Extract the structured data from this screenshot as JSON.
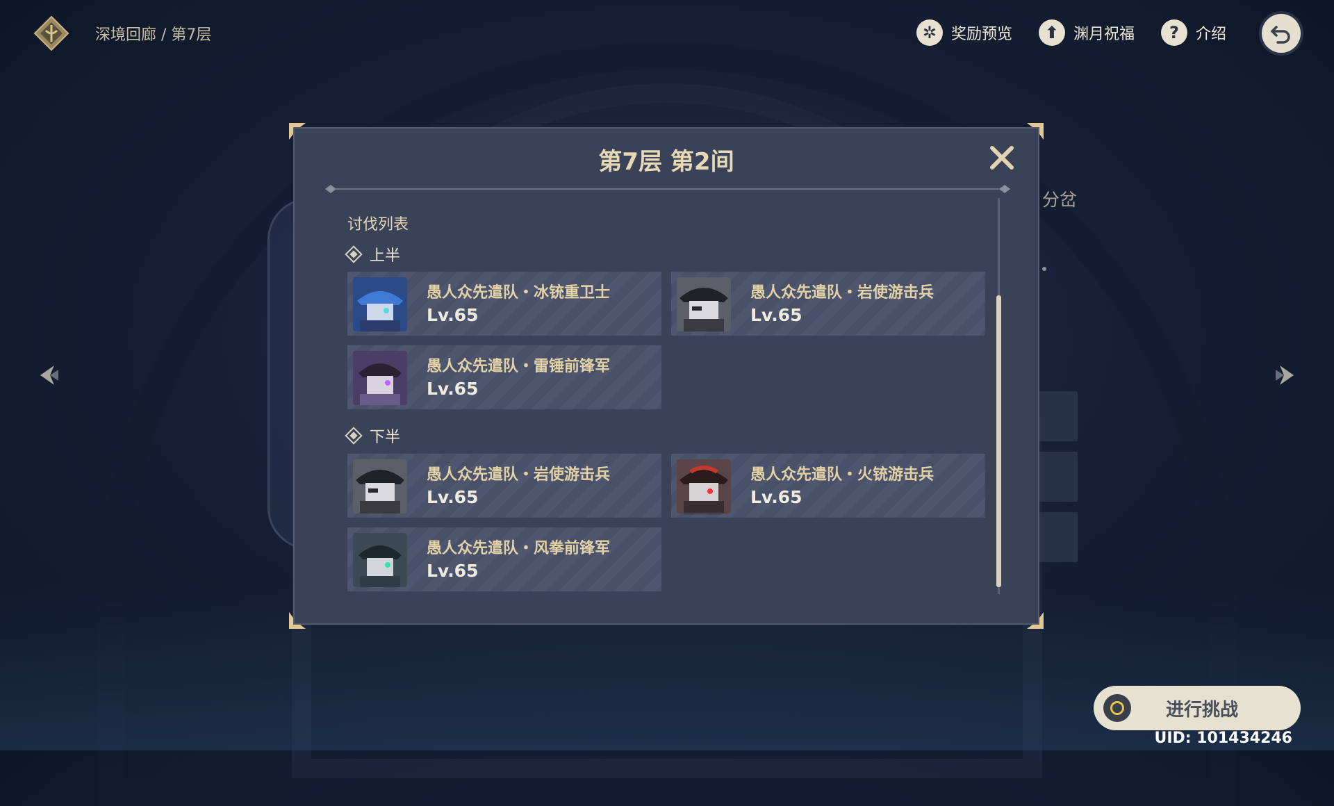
{
  "breadcrumb": "深境回廊 / 第7层",
  "top_actions": {
    "rewards_label": "奖励预览",
    "blessing_label": "渊月祝福",
    "intro_label": "介绍"
  },
  "background": {
    "side_text": "分岔"
  },
  "modal": {
    "title": "第7层 第2间",
    "list_title": "讨伐列表",
    "first_half": {
      "label": "上半",
      "enemies": [
        {
          "name": "愚人众先遣队・冰铳重卫士",
          "level": "Lv.65"
        },
        {
          "name": "愚人众先遣队・岩使游击兵",
          "level": "Lv.65"
        },
        {
          "name": "愚人众先遣队・雷锤前锋军",
          "level": "Lv.65"
        }
      ]
    },
    "second_half": {
      "label": "下半",
      "enemies": [
        {
          "name": "愚人众先遣队・岩使游击兵",
          "level": "Lv.65"
        },
        {
          "name": "愚人众先遣队・火铳游击兵",
          "level": "Lv.65"
        },
        {
          "name": "愚人众先遣队・风拳前锋军",
          "level": "Lv.65"
        }
      ]
    }
  },
  "challenge_button": "进行挑战",
  "uid": "UID: 101434246",
  "colors": {
    "modal_bg": "#3a4258",
    "gold_text": "#e3d2a6",
    "accent_gold": "#e4c14a"
  }
}
